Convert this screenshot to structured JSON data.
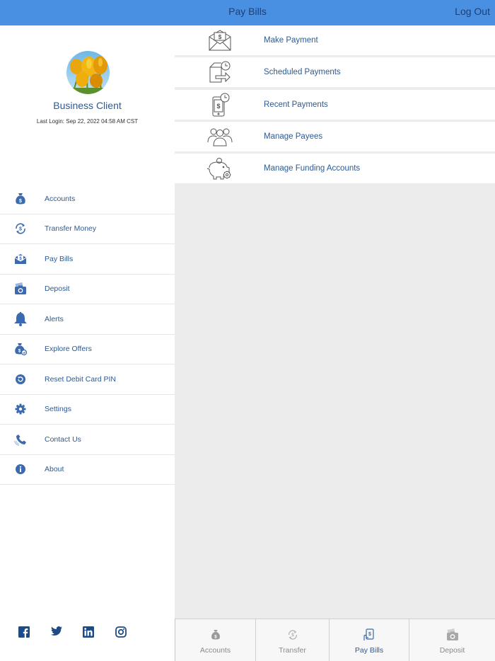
{
  "header": {
    "title": "Pay Bills",
    "logout_label": "Log Out"
  },
  "profile": {
    "name": "Business Client",
    "last_login": "Last Login: Sep 22, 2022 04:58 AM CST"
  },
  "sidebar": {
    "items": [
      {
        "label": "Accounts",
        "icon": "money-bag-icon"
      },
      {
        "label": "Transfer Money",
        "icon": "transfer-icon"
      },
      {
        "label": "Pay Bills",
        "icon": "pay-bills-icon"
      },
      {
        "label": "Deposit",
        "icon": "camera-check-icon"
      },
      {
        "label": "Alerts",
        "icon": "bell-icon"
      },
      {
        "label": "Explore Offers",
        "icon": "offers-bag-icon"
      },
      {
        "label": "Reset Debit Card PIN",
        "icon": "reset-icon"
      },
      {
        "label": "Settings",
        "icon": "gear-icon"
      },
      {
        "label": "Contact Us",
        "icon": "phone-icon"
      },
      {
        "label": "About",
        "icon": "info-icon"
      }
    ],
    "social": [
      "facebook-icon",
      "twitter-icon",
      "linkedin-icon",
      "instagram-icon"
    ]
  },
  "menu": {
    "items": [
      {
        "label": "Make Payment",
        "icon": "envelope-dollar-icon"
      },
      {
        "label": "Scheduled Payments",
        "icon": "scheduled-payment-icon"
      },
      {
        "label": "Recent Payments",
        "icon": "recent-payment-icon"
      },
      {
        "label": "Manage Payees",
        "icon": "payees-group-icon"
      },
      {
        "label": "Manage Funding Accounts",
        "icon": "piggy-bank-icon"
      }
    ]
  },
  "tabbar": {
    "tabs": [
      {
        "label": "Accounts",
        "icon": "money-bag-icon",
        "active": false
      },
      {
        "label": "Transfer",
        "icon": "transfer-icon",
        "active": false
      },
      {
        "label": "Pay Bills",
        "icon": "pay-bills-icon",
        "active": true
      },
      {
        "label": "Deposit",
        "icon": "camera-check-icon",
        "active": false
      }
    ]
  },
  "colors": {
    "topbar": "#4a90e2",
    "accent_text": "#2c5a93",
    "nav_icon": "#3b6ab0",
    "background": "#ececec"
  }
}
